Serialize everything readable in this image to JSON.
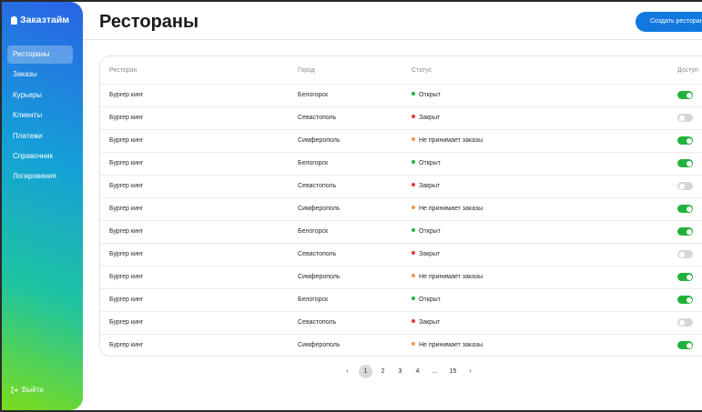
{
  "sidebar": {
    "logo": "Заказтайм",
    "items": [
      {
        "label": "Рестораны",
        "active": true
      },
      {
        "label": "Заказы",
        "active": false
      },
      {
        "label": "Курьеры",
        "active": false
      },
      {
        "label": "Клиенты",
        "active": false
      },
      {
        "label": "Платежи",
        "active": false
      },
      {
        "label": "Справочник",
        "active": false
      },
      {
        "label": "Логирования",
        "active": false
      }
    ],
    "logout": "Выйти"
  },
  "header": {
    "title": "Рестораны",
    "create_button": "Создать ресторан"
  },
  "table": {
    "columns": {
      "restaurant": "Ресторан",
      "city": "Город",
      "status": "Статус",
      "available": "Доступ"
    },
    "rows": [
      {
        "restaurant": "Бургер кинг",
        "city": "Белогорск",
        "status": "Открыт",
        "status_color": "#22b23c",
        "available": true
      },
      {
        "restaurant": "Бургер кинг",
        "city": "Севастополь",
        "status": "Закрыт",
        "status_color": "#e53935",
        "available": false
      },
      {
        "restaurant": "Бургер кинг",
        "city": "Симферополь",
        "status": "Не принимает заказы",
        "status_color": "#f2994a",
        "available": true
      },
      {
        "restaurant": "Бургер кинг",
        "city": "Белогорск",
        "status": "Открыт",
        "status_color": "#22b23c",
        "available": true
      },
      {
        "restaurant": "Бургер кинг",
        "city": "Севастополь",
        "status": "Закрыт",
        "status_color": "#e53935",
        "available": false
      },
      {
        "restaurant": "Бургер кинг",
        "city": "Симферополь",
        "status": "Не принимает заказы",
        "status_color": "#f2994a",
        "available": true
      },
      {
        "restaurant": "Бургер кинг",
        "city": "Белогорск",
        "status": "Открыт",
        "status_color": "#22b23c",
        "available": true
      },
      {
        "restaurant": "Бургер кинг",
        "city": "Севастополь",
        "status": "Закрыт",
        "status_color": "#e53935",
        "available": false
      },
      {
        "restaurant": "Бургер кинг",
        "city": "Симферополь",
        "status": "Не принимает заказы",
        "status_color": "#f2994a",
        "available": true
      },
      {
        "restaurant": "Бургер кинг",
        "city": "Белогорск",
        "status": "Открыт",
        "status_color": "#22b23c",
        "available": true
      },
      {
        "restaurant": "Бургер кинг",
        "city": "Севастополь",
        "status": "Закрыт",
        "status_color": "#e53935",
        "available": false
      },
      {
        "restaurant": "Бургер кинг",
        "city": "Симферополь",
        "status": "Не принимает заказы",
        "status_color": "#f2994a",
        "available": true
      }
    ]
  },
  "pagination": {
    "prev": "‹",
    "pages": [
      "1",
      "2",
      "3",
      "4",
      "...",
      "15"
    ],
    "current": "1",
    "next": "›"
  },
  "colors": {
    "accent": "#1178e0",
    "toggle_on": "#22b23c",
    "toggle_off": "#d6d6d6"
  }
}
